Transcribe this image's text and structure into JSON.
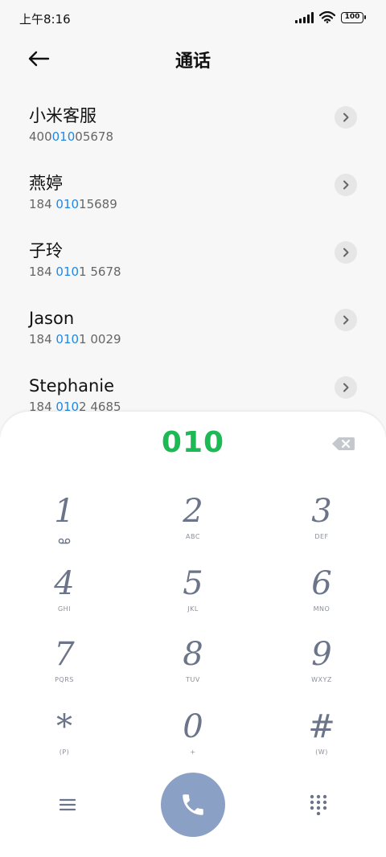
{
  "status_bar": {
    "time": "上午8:16",
    "battery": "100"
  },
  "header": {
    "title": "通话"
  },
  "contacts": [
    {
      "name": "小米客服",
      "number_pre": "400",
      "number_match": "010",
      "number_post": "05678"
    },
    {
      "name": "燕婷",
      "number_pre": "184 ",
      "number_match": "010",
      "number_post": "15689"
    },
    {
      "name": "子玲",
      "number_pre": "184 ",
      "number_match": "010",
      "number_post": "1 5678"
    },
    {
      "name": "Jason",
      "number_pre": "184 ",
      "number_match": "010",
      "number_post": "1 0029"
    },
    {
      "name": "Stephanie",
      "number_pre": "184 ",
      "number_match": "010",
      "number_post": "2 4685"
    }
  ],
  "dialer": {
    "input_value": "010",
    "keys": [
      {
        "digit": "1",
        "sub": ""
      },
      {
        "digit": "2",
        "sub": "ABC"
      },
      {
        "digit": "3",
        "sub": "DEF"
      },
      {
        "digit": "4",
        "sub": "GHI"
      },
      {
        "digit": "5",
        "sub": "JKL"
      },
      {
        "digit": "6",
        "sub": "MNO"
      },
      {
        "digit": "7",
        "sub": "PQRS"
      },
      {
        "digit": "8",
        "sub": "TUV"
      },
      {
        "digit": "9",
        "sub": "WXYZ"
      },
      {
        "digit": "*",
        "sub": "(P)"
      },
      {
        "digit": "0",
        "sub": "+"
      },
      {
        "digit": "#",
        "sub": "(W)"
      }
    ]
  },
  "colors": {
    "match_highlight": "#1e88e5",
    "dial_input": "#1db954",
    "call_button": "#8aa0c4"
  }
}
